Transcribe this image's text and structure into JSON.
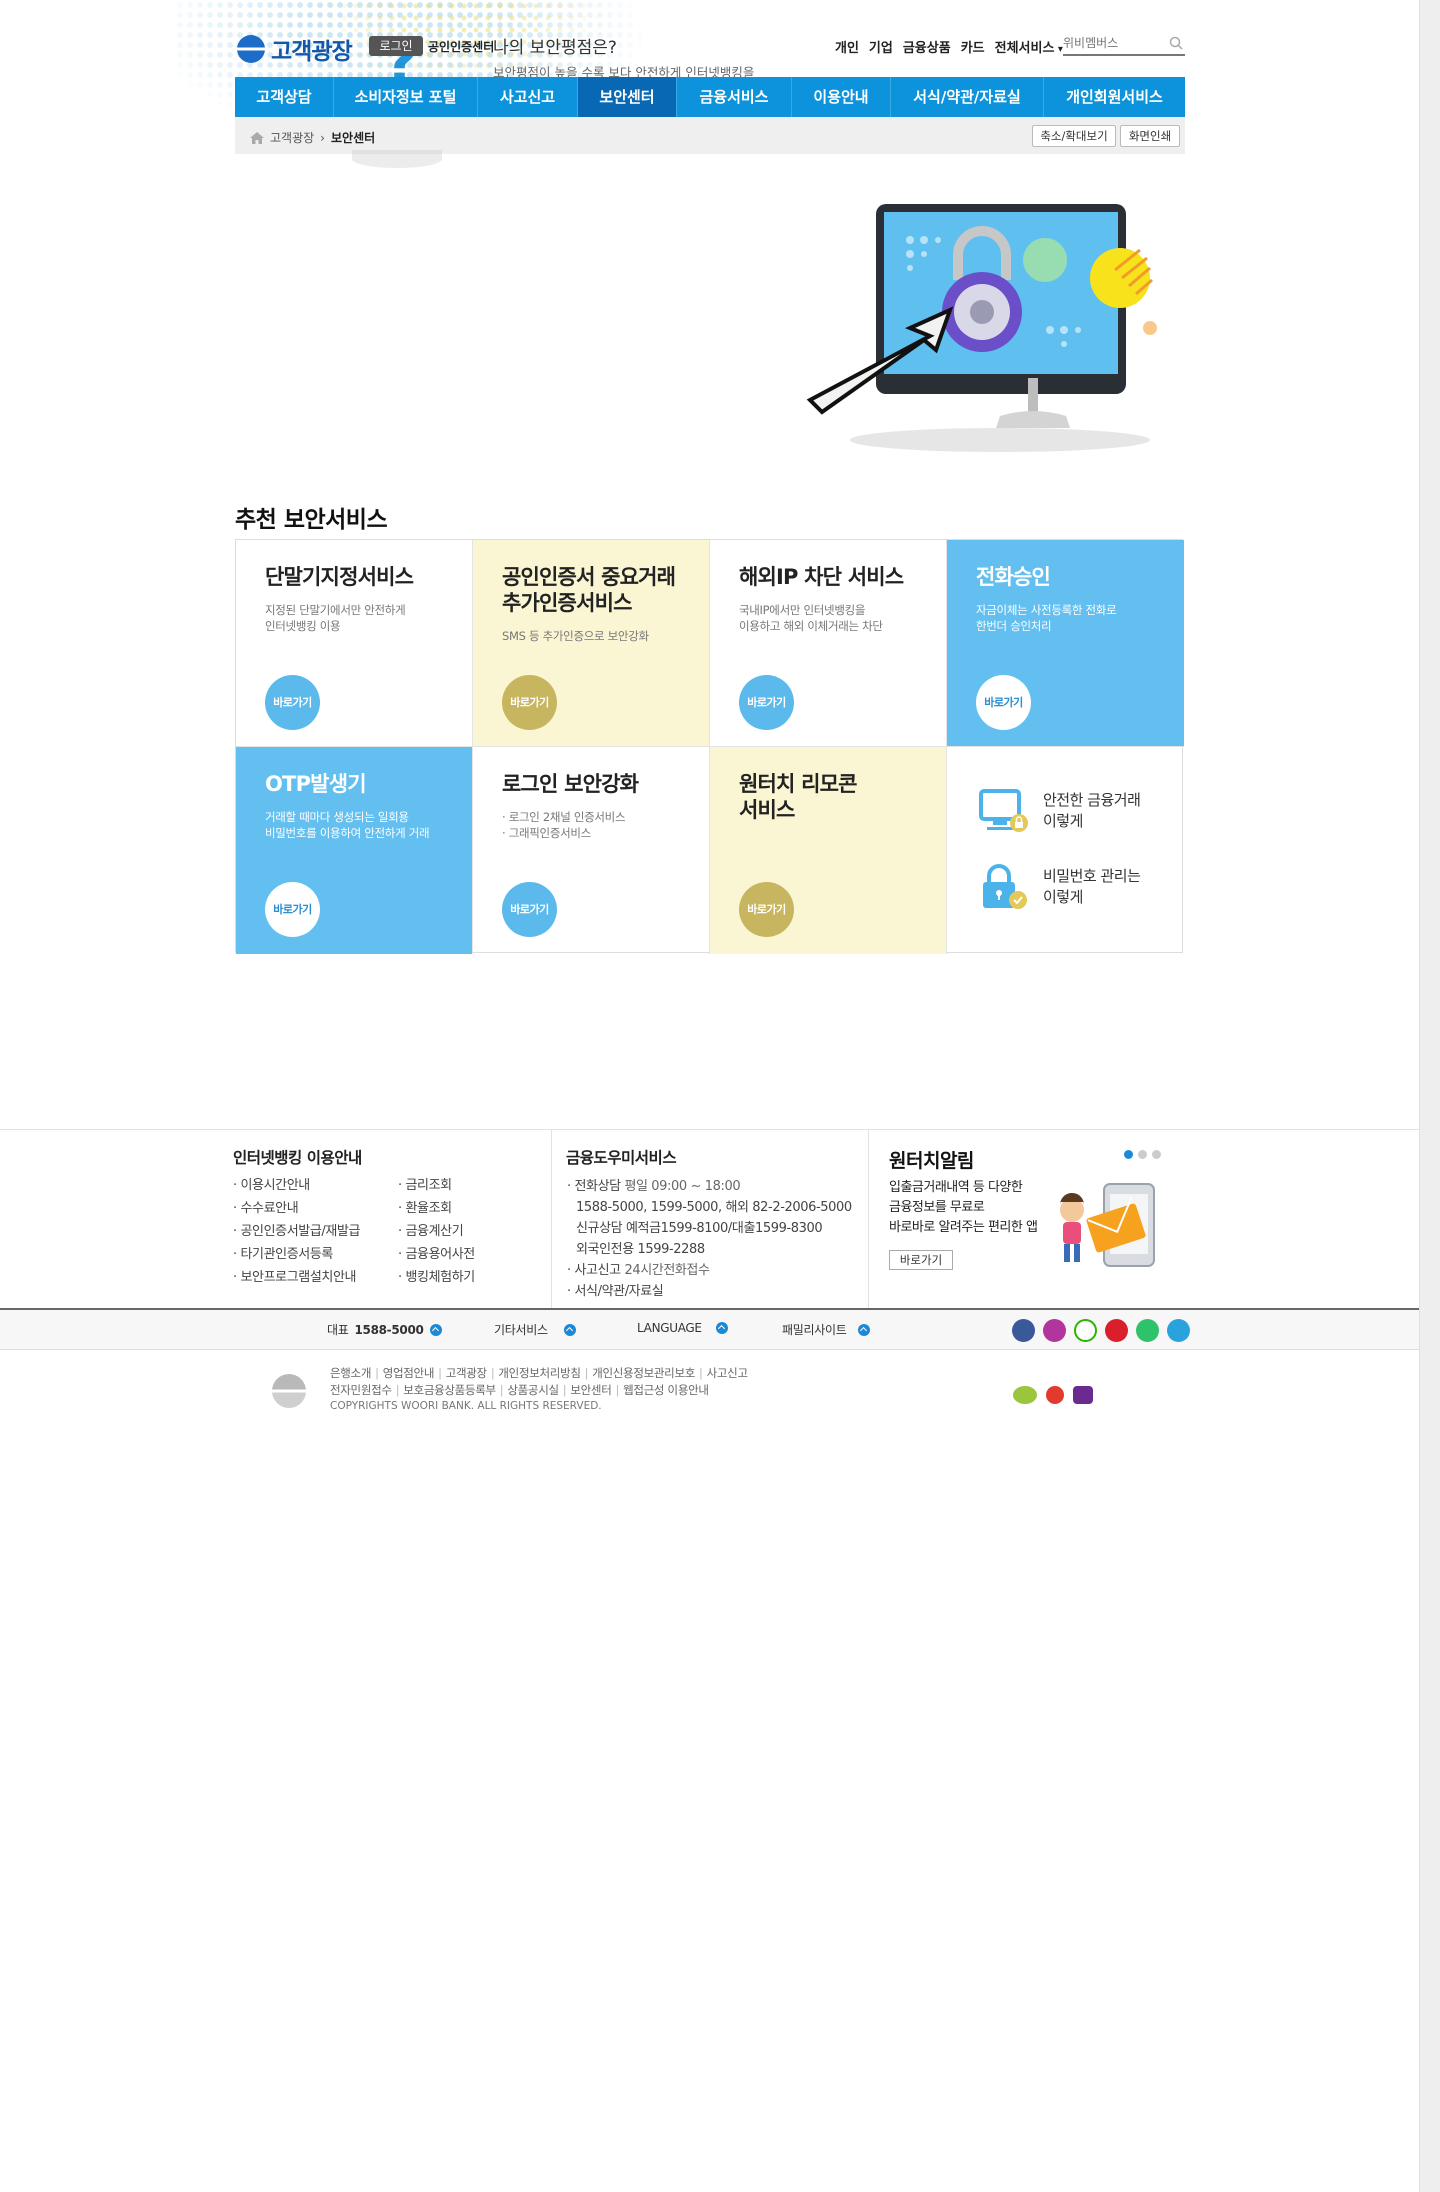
{
  "header": {
    "logo_text": "고객광장",
    "login_label": "로그인",
    "cert_link": "공인인증센터",
    "promo_title": "나의 보안평점은?",
    "promo_sub": "보안평점이 높을 수록 보다 안전하게 인터넷뱅킹을",
    "top_links": [
      "개인",
      "기업",
      "금융상품",
      "카드",
      "전체서비스"
    ],
    "search_placeholder": "위비멤버스"
  },
  "gnb": [
    {
      "label": "고객상담",
      "active": false
    },
    {
      "label": "소비자정보 포털",
      "active": false
    },
    {
      "label": "사고신고",
      "active": false
    },
    {
      "label": "보안센터",
      "active": true
    },
    {
      "label": "금융서비스",
      "active": false
    },
    {
      "label": "이용안내",
      "active": false
    },
    {
      "label": "서식/약관/자료실",
      "active": false
    },
    {
      "label": "개인회원서비스",
      "active": false
    }
  ],
  "breadcrumb": {
    "home": "고객광장",
    "current": "보안센터"
  },
  "controls": {
    "zoom": "축소/확대보기",
    "print": "화면인쇄"
  },
  "section_title": "추천 보안서비스",
  "services": [
    {
      "title": "단말기지정서비스",
      "desc": "지정된 단말기에서만 안전하게\n인터넷뱅킹 이용",
      "button": "바로가기",
      "theme": "white"
    },
    {
      "title": "공인인증서 중요거래\n추가인증서비스",
      "desc": "SMS 등 추가인증으로 보안강화",
      "button": "바로가기",
      "theme": "cream"
    },
    {
      "title": "해외IP 차단 서비스",
      "desc": "국내IP에서만 인터넷뱅킹을\n이용하고 해외 이체거래는 차단",
      "button": "바로가기",
      "theme": "white"
    },
    {
      "title": "전화승인",
      "desc": "자금이체는 사전등록한 전화로\n한번더 승인처리",
      "button": "바로가기",
      "theme": "blue"
    },
    {
      "title": "OTP발생기",
      "desc": "거래할 때마다 생성되는 일회용\n비밀번호를 이용하여 안전하게 거래",
      "button": "바로가기",
      "theme": "blue"
    },
    {
      "title": "로그인 보안강화",
      "desc": "· 로그인 2채널 인증서비스\n· 그래픽인증서비스",
      "button": "바로가기",
      "theme": "white"
    },
    {
      "title": "원터치 리모콘\n서비스",
      "desc": "",
      "button": "바로가기",
      "theme": "cream"
    }
  ],
  "tips": [
    {
      "label": "안전한 금융거래\n이렇게",
      "icon": "monitor-lock-icon"
    },
    {
      "label": "비밀번호 관리는\n이렇게",
      "icon": "padlock-check-icon"
    }
  ],
  "footer": {
    "ib_title": "인터넷뱅킹 이용안내",
    "ib_col1": [
      "이용시간안내",
      "수수료안내",
      "공인인증서발급/재발급",
      "타기관인증서등록",
      "보안프로그램설치안내"
    ],
    "ib_col2": [
      "금리조회",
      "환율조회",
      "금융계산기",
      "금융용어사전",
      "뱅킹체험하기"
    ],
    "svc_title": "금융도우미서비스",
    "svc": {
      "phone_label": "전화상담",
      "phone_hours": "평일 09:00 ~ 18:00",
      "phone_numbers": "1588-5000, 1599-5000, 해외 82-2-2006-5000",
      "new_consult": "신규상담 예적금1599-8100/대출1599-8300",
      "foreign": "외국인전용 1599-2288",
      "accident_label": "사고신고",
      "accident_desc": "24시간전화접수",
      "forms": "서식/약관/자료실"
    },
    "alarm_title": "원터치알림",
    "alarm_desc": "입출금거래내역 등 다양한\n금융정보를 무료로\n바로바로 알려주는 편리한 앱",
    "alarm_button": "바로가기",
    "bar": {
      "rep_label": "대표",
      "rep_number": "1588-5000",
      "etc": "기타서비스",
      "language": "LANGUAGE",
      "family": "패밀리사이트"
    },
    "social": [
      "facebook-icon",
      "instagram-icon",
      "blog-icon",
      "youtube-icon",
      "play-icon",
      "twitter-icon"
    ],
    "corp_links_1": [
      "은행소개",
      "영업점안내",
      "고객광장",
      "개인정보처리방침",
      "개인신용정보관리보호",
      "사고신고"
    ],
    "corp_links_2": [
      "전자민원접수",
      "보호금융상품등록부",
      "상품공시실",
      "보안센터",
      "웹접근성 이용안내"
    ],
    "copyright": "COPYRIGHTS WOORI BANK. ALL RIGHTS RESERVED."
  },
  "colors": {
    "primary": "#0c93db",
    "active_nav": "#0968b3",
    "tile_blue": "#62bff0",
    "tile_cream": "#faf6d3",
    "btn_gold": "#c8b560"
  }
}
